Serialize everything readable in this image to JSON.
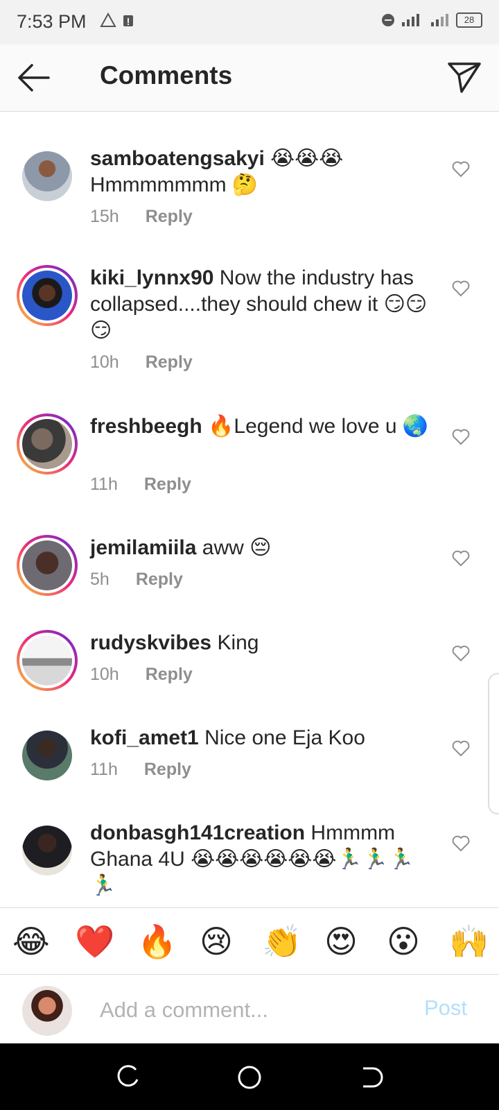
{
  "status": {
    "time": "7:53 PM",
    "battery": "28"
  },
  "header": {
    "title": "Comments"
  },
  "comments": [
    {
      "username": "samboatengsakyi",
      "text": "😭😭😭 Hmmmmmmm 🤔",
      "time": "15h",
      "reply": "Reply"
    },
    {
      "username": "kiki_lynnx90",
      "text": "Now the industry has collapsed....they should chew it 😏😏😏",
      "time": "10h",
      "reply": "Reply"
    },
    {
      "username": "freshbeegh",
      "text": "🔥Legend we love u 🌏",
      "time": "11h",
      "reply": "Reply"
    },
    {
      "username": "jemilamiila",
      "text": "aww 😔",
      "time": "5h",
      "reply": "Reply"
    },
    {
      "username": "rudyskvibes",
      "text": "King",
      "time": "10h",
      "reply": "Reply"
    },
    {
      "username": "kofi_amet1",
      "text": "Nice one Eja Koo",
      "time": "11h",
      "reply": "Reply"
    },
    {
      "username": "donbasgh141creation",
      "text": "Hmmmm Ghana 4U 😭😭😭😭😭😭🏃‍♂️🏃‍♂️🏃‍♂️🏃‍♂️",
      "time": "",
      "reply": ""
    }
  ],
  "quick_emojis": [
    "😂",
    "❤️",
    "🔥",
    "😢",
    "👏",
    "😍",
    "😮",
    "🙌"
  ],
  "composer": {
    "placeholder": "Add a comment...",
    "post_label": "Post"
  },
  "colors": {
    "ring_gradient": [
      "#f9ce34",
      "#ee2a7b",
      "#6228d7"
    ],
    "post_disabled": "#b2dffc",
    "meta_gray": "#8e8e8e"
  },
  "icons": {
    "back": "arrow-left-icon",
    "share": "paper-plane-icon",
    "like": "heart-outline-icon"
  }
}
